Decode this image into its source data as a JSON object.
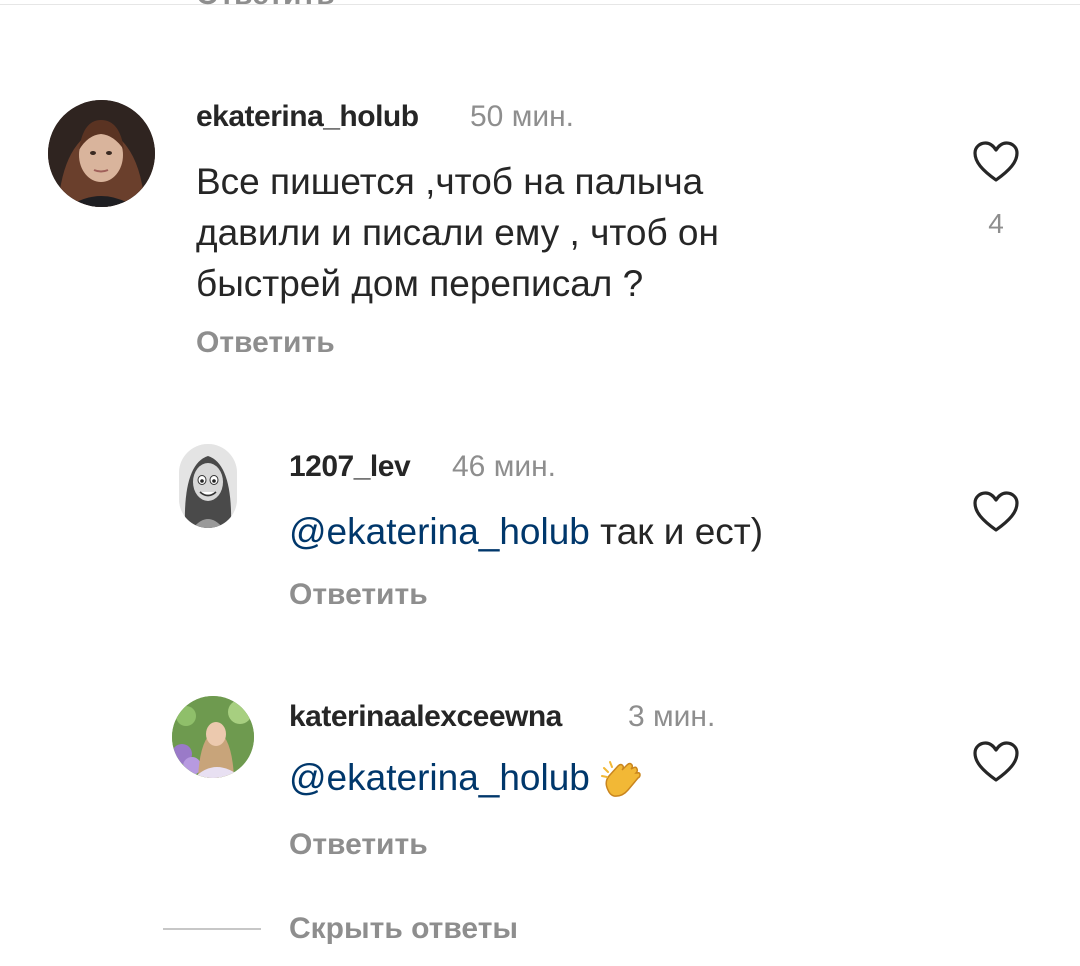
{
  "top": {
    "clipped_label": "Ответить"
  },
  "comments": [
    {
      "username": "ekaterina_holub",
      "time": "50 мин.",
      "text_lines": [
        "Все пишется ,чтоб на палыча",
        "давили и писали ему , чтоб он",
        "быстрей дом переписал ?"
      ],
      "reply_label": "Ответить",
      "likes": "4"
    },
    {
      "username": "1207_lev",
      "time": "46 мин.",
      "mention": "@ekaterina_holub",
      "text": " так и ест)",
      "reply_label": "Ответить"
    },
    {
      "username": "katerinaalexceewna",
      "time": "3 мин.",
      "mention": "@ekaterina_holub",
      "emoji": "clapping-hands-emoji",
      "reply_label": "Ответить"
    }
  ],
  "hide_replies_label": "Скрыть ответы",
  "colors": {
    "text": "#262626",
    "secondary": "#8e8e8e",
    "mention": "#00376b"
  }
}
